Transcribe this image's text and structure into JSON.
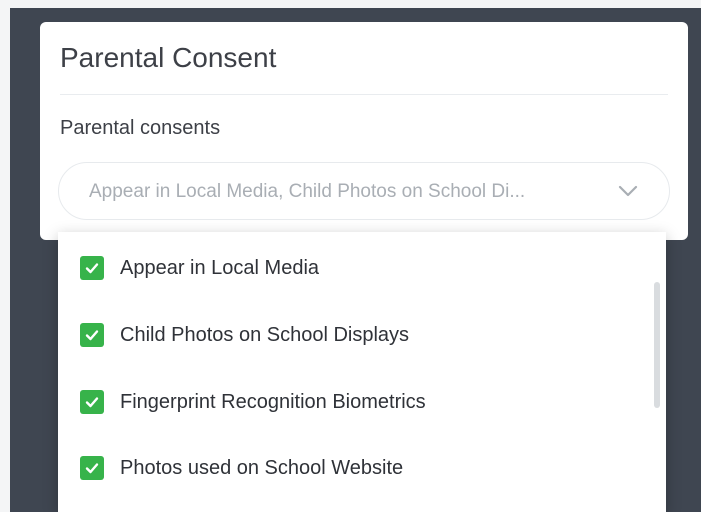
{
  "panel": {
    "title": "Parental Consent",
    "field_label": "Parental consents",
    "select": {
      "value": "Appear in Local Media, Child Photos on School Di..."
    }
  },
  "dropdown": {
    "options": [
      {
        "label": "Appear in Local Media",
        "checked": true
      },
      {
        "label": "Child Photos on School Displays",
        "checked": true
      },
      {
        "label": "Fingerprint Recognition Biometrics",
        "checked": true
      },
      {
        "label": "Photos used on School Website",
        "checked": true
      }
    ]
  },
  "colors": {
    "checkbox": "#37b34a",
    "backdrop": "#3f4651",
    "placeholder_text": "#a9aeb4"
  },
  "icons": {
    "dropdown": "chevron-down-icon",
    "check": "check-icon"
  }
}
